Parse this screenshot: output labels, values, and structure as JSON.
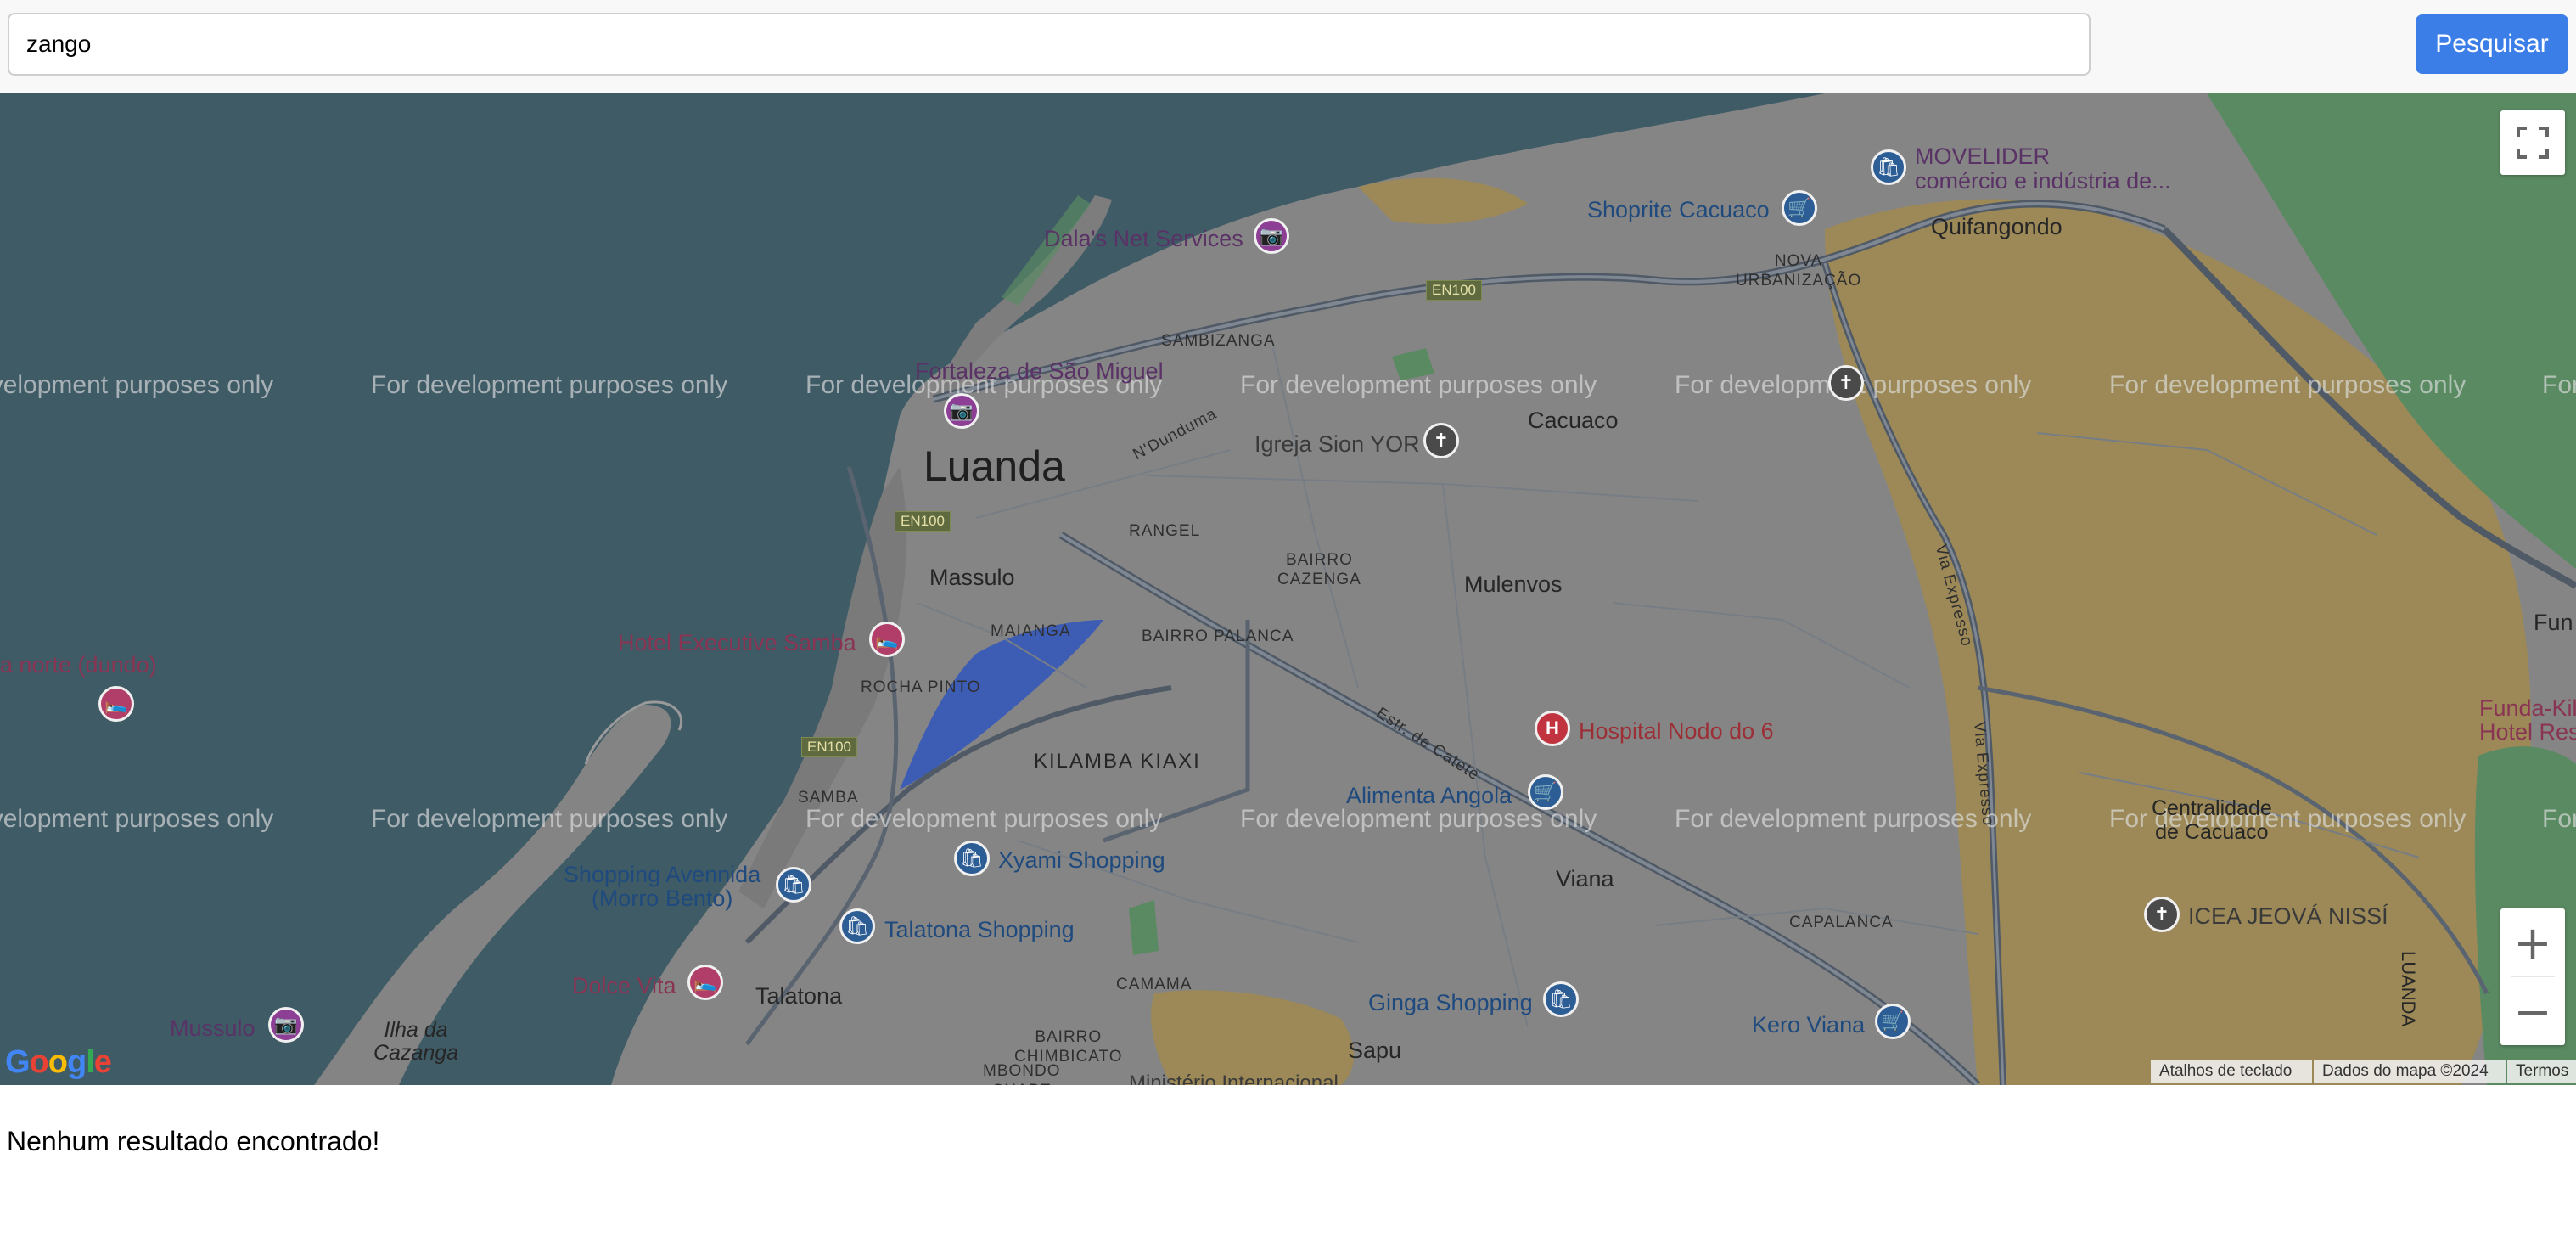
{
  "search": {
    "value": "zango",
    "button_label": "Pesquisar"
  },
  "map": {
    "watermark": "For development purposes only",
    "cities": {
      "luanda": "Luanda",
      "cacuaco": "Cacuaco",
      "quifangondo": "Quifangondo",
      "massulo": "Massulo",
      "mulenvos": "Mulenvos",
      "viana": "Viana",
      "talatona": "Talatona",
      "sapu": "Sapu",
      "ilha_cazanga": "Ilha da\nCazanga",
      "centralidade": "Centralidade\nde Cacuaco",
      "fun": "Fun"
    },
    "neighborhoods": {
      "sambizanga": "SAMBIZANGA",
      "nova_urbanizacao": "NOVA\nURBANIZAÇÃO",
      "rangel": "RANGEL",
      "bairro_cazenga": "BAIRRO\nCAZENGA",
      "maianga": "MAIANGA",
      "bairro_palanca": "BAIRRO PALANCA",
      "rocha_pinto": "ROCHA PINTO",
      "kilamba_kiaxi": "KILAMBA KIAXI",
      "samba": "SAMBA",
      "capalanca": "CAPALANCA",
      "camama": "CAMAMA",
      "bairro_chimbicato": "BAIRRO\nCHIMBICATO",
      "mbondo_chape": "MBONDO\nCHAPE",
      "luanda_prov": "LUANDA"
    },
    "roads": {
      "en100_a": "EN100",
      "en100_b": "EN100",
      "en100_c": "EN100",
      "n_dunduma": "N'Dunduma",
      "estr_catete": "Estr. de Catete",
      "via_expresso_1": "Via Expresso",
      "via_expresso_2": "Via Expresso"
    },
    "pois": {
      "movelider": "MOVELIDER\ncomércio e indústria de...",
      "shoprite": "Shoprite Cacuaco",
      "dalas": "Dala's Net Services",
      "fortaleza": "Fortaleza de São Miguel",
      "igreja": "Igreja Sion YOR",
      "hotel_samba": "Hotel Executive Samba",
      "norte": "a norte (dundo)",
      "hospital": "Hospital Nodo do 6",
      "alimenta": "Alimenta Angola",
      "xyami": "Xyami Shopping",
      "avennida": "Shopping Avennida\n(Morro Bento)",
      "talatona_shop": "Talatona Shopping",
      "dolce": "Dolce Vita",
      "mussulo": "Mussulo",
      "ginga": "Ginga Shopping",
      "kero": "Kero Viana",
      "icea": "ICEA JEOVÁ NISSÍ",
      "funda": "Funda-Kilun\nHotel Restaura",
      "ministerio": "Ministério Internacional"
    },
    "controls": {
      "zoom_in": "+",
      "zoom_out": "−"
    },
    "attribution": {
      "shortcuts": "Atalhos de teclado",
      "map_data": "Dados do mapa ©2024",
      "terms": "Termos"
    },
    "logo": "Google"
  },
  "result_message": "Nenhum resultado encontrado!"
}
